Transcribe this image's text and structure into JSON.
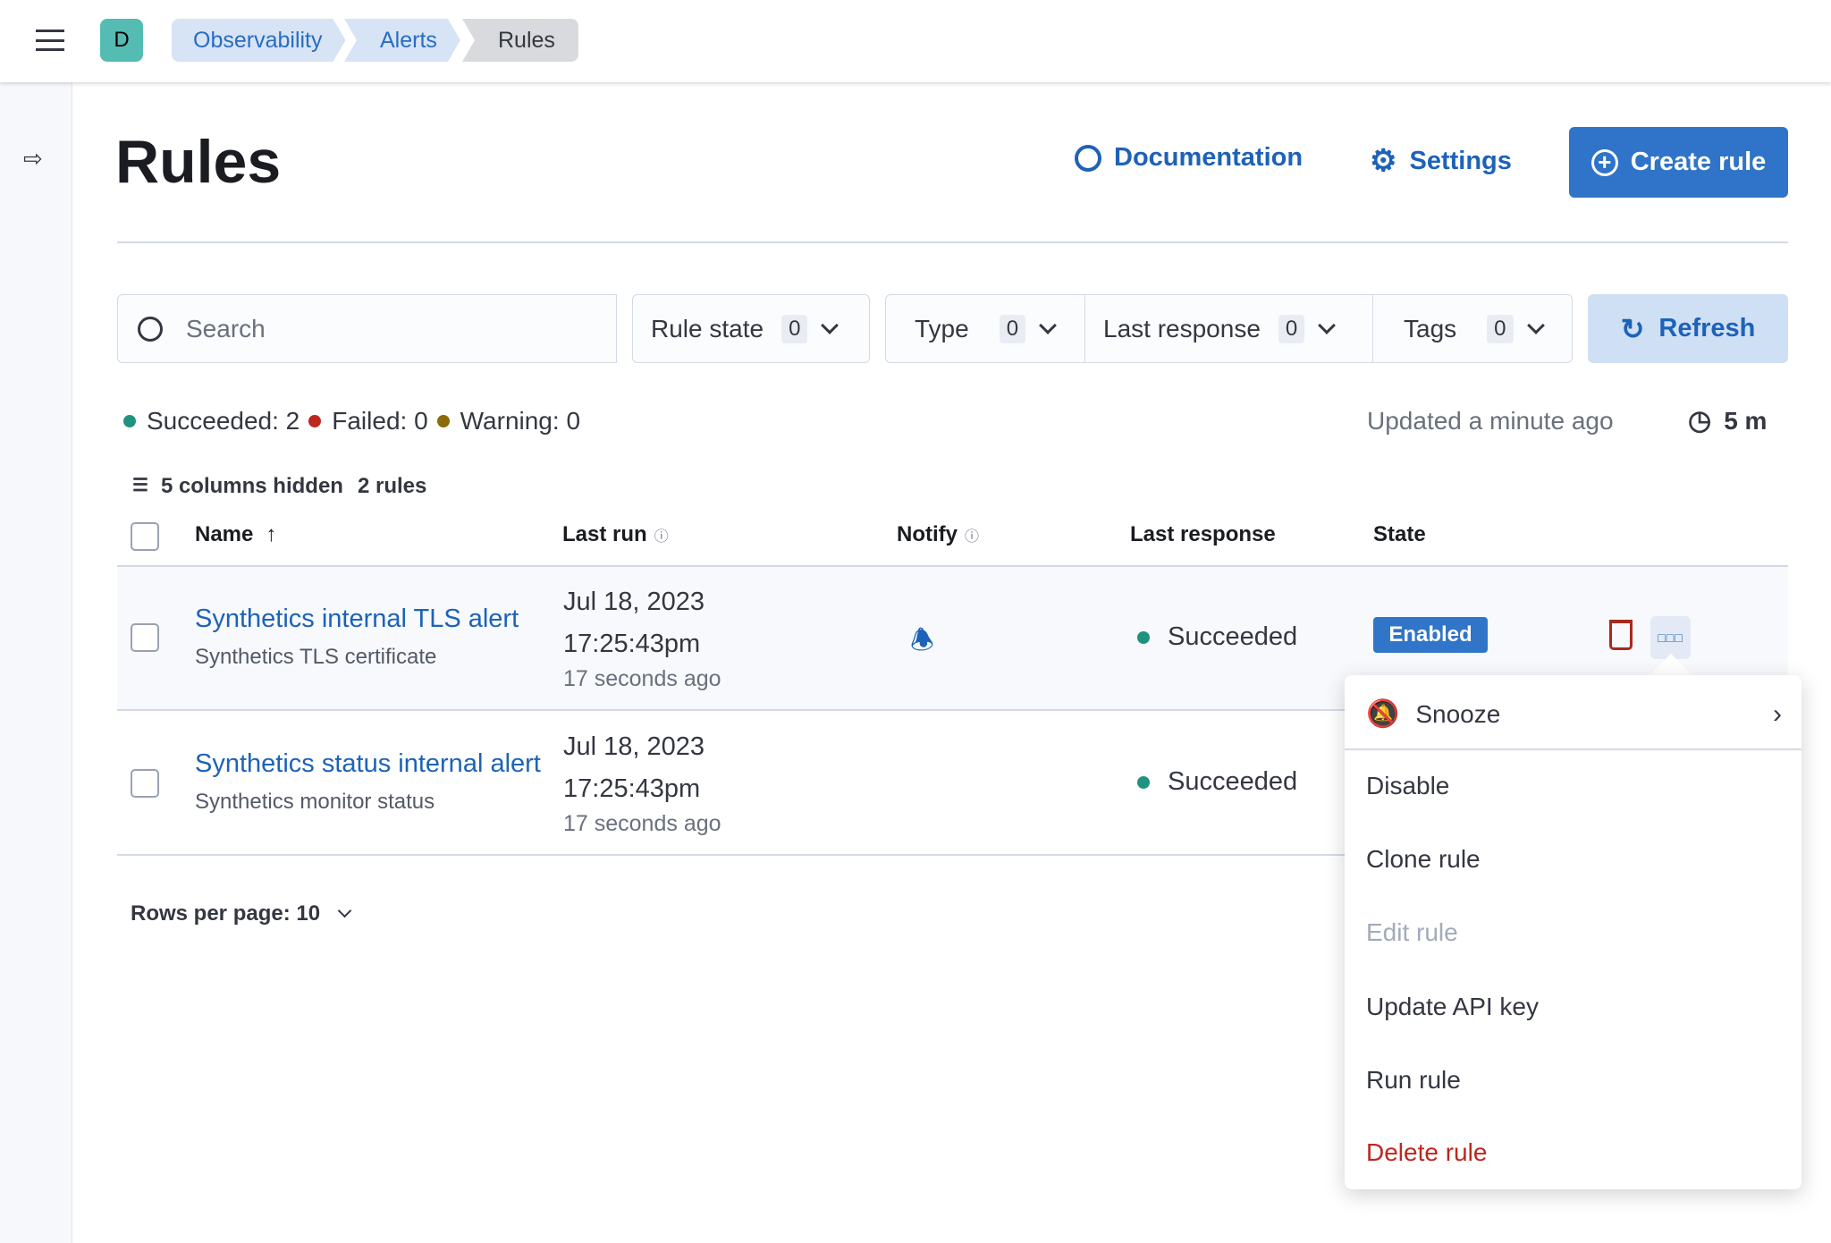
{
  "header": {
    "avatar": "D",
    "breadcrumbs": [
      "Observability",
      "Alerts",
      "Rules"
    ]
  },
  "page": {
    "title": "Rules",
    "documentation": "Documentation",
    "settings": "Settings",
    "create_rule": "Create rule"
  },
  "filters": {
    "search_placeholder": "Search",
    "rule_state": "Rule state",
    "type": "Type",
    "last_response": "Last response",
    "tags": "Tags",
    "count": "0",
    "refresh": "Refresh"
  },
  "status": {
    "succeeded": "Succeeded: 2",
    "failed": "Failed: 0",
    "warning": "Warning: 0",
    "updated": "Updated a minute ago",
    "interval": "5 m",
    "colors": {
      "succeeded": "#209280",
      "failed": "#bd271e",
      "warning": "#8a6a0a"
    }
  },
  "table": {
    "columns_hidden": "5 columns hidden",
    "rule_count": "2 rules",
    "headers": {
      "name": "Name",
      "last_run": "Last run",
      "notify": "Notify",
      "last_response": "Last response",
      "state": "State"
    },
    "rows": [
      {
        "name": "Synthetics internal TLS alert",
        "type": "Synthetics TLS certificate",
        "date": "Jul 18, 2023",
        "time": "17:25:43pm",
        "ago": "17 seconds ago",
        "response": "Succeeded",
        "state": "Enabled"
      },
      {
        "name": "Synthetics status internal alert",
        "type": "Synthetics monitor status",
        "date": "Jul 18, 2023",
        "time": "17:25:43pm",
        "ago": "17 seconds ago",
        "response": "Succeeded"
      }
    ],
    "rows_per_page": "Rows per page: 10"
  },
  "menu": {
    "items": [
      "Snooze",
      "Disable",
      "Clone rule",
      "Edit rule",
      "Update API key",
      "Run rule",
      "Delete rule"
    ]
  }
}
